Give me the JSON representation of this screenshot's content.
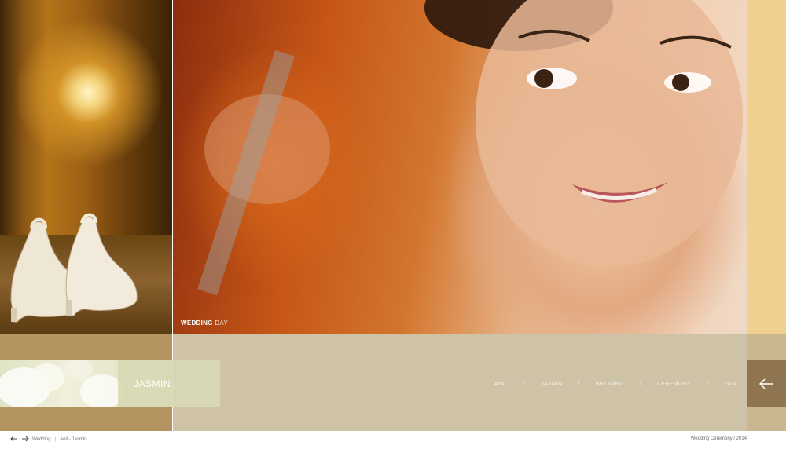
{
  "caption": {
    "bold": "WEDDING",
    "light": " DAY"
  },
  "name_label": "JASMIN",
  "tagline": [
    "ANIL",
    "JASMIN",
    "WEDDING",
    "CEREMONY",
    "2014"
  ],
  "tagline_separator": "/",
  "footer": {
    "category": "Wedding",
    "couple": "Anil - Jasmin",
    "event": "Wedding Ceremony / 2014"
  },
  "icons": {
    "back": "arrow-left-icon",
    "prev": "arrow-left-icon",
    "next": "arrow-right-icon"
  },
  "colors": {
    "gold_strip": "#efd08e",
    "band": "#cec3a6",
    "dark_band": "#b49562",
    "back_button": "#8f7650"
  }
}
